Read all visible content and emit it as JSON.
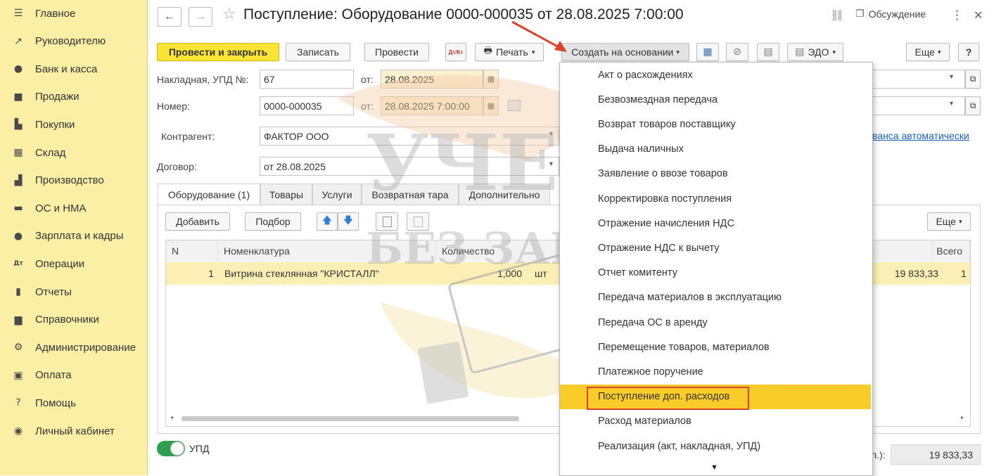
{
  "sidebar": {
    "items": [
      {
        "label": "Главное",
        "icon": "menu-icon",
        "glyph": "☰"
      },
      {
        "label": "Руководителю",
        "icon": "chart-line-icon",
        "glyph": "↗"
      },
      {
        "label": "Банк и касса",
        "icon": "coin-icon",
        "glyph": "●"
      },
      {
        "label": "Продажи",
        "icon": "shopping-bag-icon",
        "glyph": "■"
      },
      {
        "label": "Покупки",
        "icon": "cart-icon",
        "glyph": "▙"
      },
      {
        "label": "Склад",
        "icon": "warehouse-icon",
        "glyph": "▦"
      },
      {
        "label": "Производство",
        "icon": "factory-icon",
        "glyph": "▟"
      },
      {
        "label": "ОС и НМА",
        "icon": "truck-icon",
        "glyph": "▬"
      },
      {
        "label": "Зарплата и кадры",
        "icon": "person-icon",
        "glyph": "●"
      },
      {
        "label": "Операции",
        "icon": "dt-kt-icon",
        "glyph": "Дт"
      },
      {
        "label": "Отчеты",
        "icon": "bar-chart-icon",
        "glyph": "▮"
      },
      {
        "label": "Справочники",
        "icon": "book-icon",
        "glyph": "▆"
      },
      {
        "label": "Администрирование",
        "icon": "gear-icon",
        "glyph": "⚙"
      },
      {
        "label": "Оплата",
        "icon": "wallet-icon",
        "glyph": "▣"
      },
      {
        "label": "Помощь",
        "icon": "question-icon",
        "glyph": "?"
      },
      {
        "label": "Личный кабинет",
        "icon": "user-circle-icon",
        "glyph": "◉"
      }
    ]
  },
  "header": {
    "back_icon": "←",
    "forward_icon": "→",
    "star_icon": "☆",
    "title": "Поступление: Оборудование 0000-000035 от 28.08.2025 7:00:00",
    "link_icon": "⛓",
    "discussion_icon": "❐",
    "discussion_label": "Обсуждение",
    "more_icon": "⋮",
    "close_icon": "✕"
  },
  "toolbar": {
    "post_close": "Провести и закрыть",
    "save": "Записать",
    "post": "Провести",
    "dtkt": "Дт/Кт",
    "print": "Печать",
    "print_icon": "🖶",
    "create_based": "Создать на основании",
    "structure_icon": "▦",
    "attach_icon": "⊘",
    "report_icon": "▤",
    "edo": "ЭДО",
    "edo_icon": "▤",
    "more": "Еще",
    "help": "?"
  },
  "form": {
    "invoice_label": "Накладная, УПД №:",
    "invoice_no": "67",
    "from_label": "от:",
    "invoice_date": "28.08.2025",
    "number_label": "Номер:",
    "number": "0000-000035",
    "number_date": "28.08.2025  7:00:00",
    "counterparty_label": "Контрагент:",
    "counterparty": "ФАКТОР ООО",
    "contract_label": "Договор:",
    "contract": "от 28.08.2025",
    "advance_link": "ванса автоматически",
    "dropdown_arrow": "▾",
    "open_icon": "⧉",
    "calendar_icon": "▦"
  },
  "tabs": [
    {
      "label": "Оборудование (1)",
      "active": true
    },
    {
      "label": "Товары",
      "active": false
    },
    {
      "label": "Услуги",
      "active": false
    },
    {
      "label": "Возвратная тара",
      "active": false
    },
    {
      "label": "Дополнительно",
      "active": false
    }
  ],
  "table_toolbar": {
    "add": "Добавить",
    "pick": "Подбор",
    "up_icon": "🡅",
    "down_icon": "🡇",
    "more": "Еще"
  },
  "table": {
    "columns": [
      "N",
      "Номенклатура",
      "Количество",
      "Всего"
    ],
    "rows": [
      {
        "n": "1",
        "item": "Витрина стеклянная \"КРИСТАЛЛ\"",
        "qty": "1,000",
        "unit": "шт",
        "sum": "19 833,33",
        "total": "1"
      }
    ]
  },
  "footer": {
    "toggle_label": "УПД",
    "toggle_on": true,
    "total_suffix": "л.):",
    "total": "19 833,33"
  },
  "menu": {
    "items": [
      "Акт о расхождениях",
      "Безвозмездная передача",
      "Возврат товаров поставщику",
      "Выдача наличных",
      "Заявление о ввозе товаров",
      "Корректировка поступления",
      "Отражение начисления НДС",
      "Отражение НДС к вычету",
      "Отчет комитенту",
      "Передача материалов в эксплуатацию",
      "Передача ОС в аренду",
      "Перемещение товаров, материалов",
      "Платежное поручение",
      "Поступление доп. расходов",
      "Расход материалов",
      "Реализация (акт, накладная, УПД)"
    ],
    "highlighted_index": 13,
    "scroll_down_icon": "▼"
  },
  "watermark": {
    "line1": "УЧЕТ",
    "line2": "БЕЗ ЗАБОТ"
  },
  "colors": {
    "sidebar_bg": "#fbeea5",
    "primary_button": "#fce436",
    "menu_highlight": "#f9cc2a",
    "annotation_red": "#d9442e",
    "link_blue": "#1a5fb4",
    "toggle_green": "#2e9e4f"
  }
}
